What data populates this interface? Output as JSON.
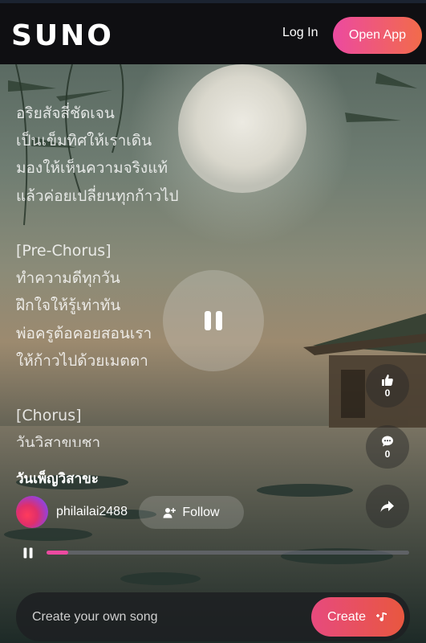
{
  "header": {
    "logo": "SUNO",
    "login_label": "Log In",
    "open_app_label": "Open App"
  },
  "lyrics": [
    "อริยสัจสี่ชัดเจน",
    "เป็นเข็มทิศให้เราเดิน",
    "มองให้เห็นความจริงแท้",
    "แล้วค่อยเปลี่ยนทุกก้าวไป",
    "",
    "[Pre-Chorus]",
    "ทำความดีทุกวัน",
    "ฝึกใจให้รู้เท่าทัน",
    "พ่อครูต้อคอยสอนเรา",
    "ให้ก้าวไปด้วยเมตตา",
    "",
    "[Chorus]",
    "วันวิสาขบูชา"
  ],
  "player": {
    "state": "playing",
    "progress": 0.06
  },
  "actions": {
    "like_count": "0",
    "comment_count": "0"
  },
  "song": {
    "title": "วันเพ็ญวิสาขะ",
    "username": "philailai2488",
    "follow_label": "Follow"
  },
  "create": {
    "placeholder": "Create your own song",
    "button_label": "Create"
  },
  "colors": {
    "accent_pink": "#ec4aa0",
    "accent_orange": "#f26b4a"
  },
  "icons": [
    "pause-icon",
    "like-icon",
    "comment-icon",
    "share-icon",
    "add-user-icon",
    "music-note-icon"
  ]
}
